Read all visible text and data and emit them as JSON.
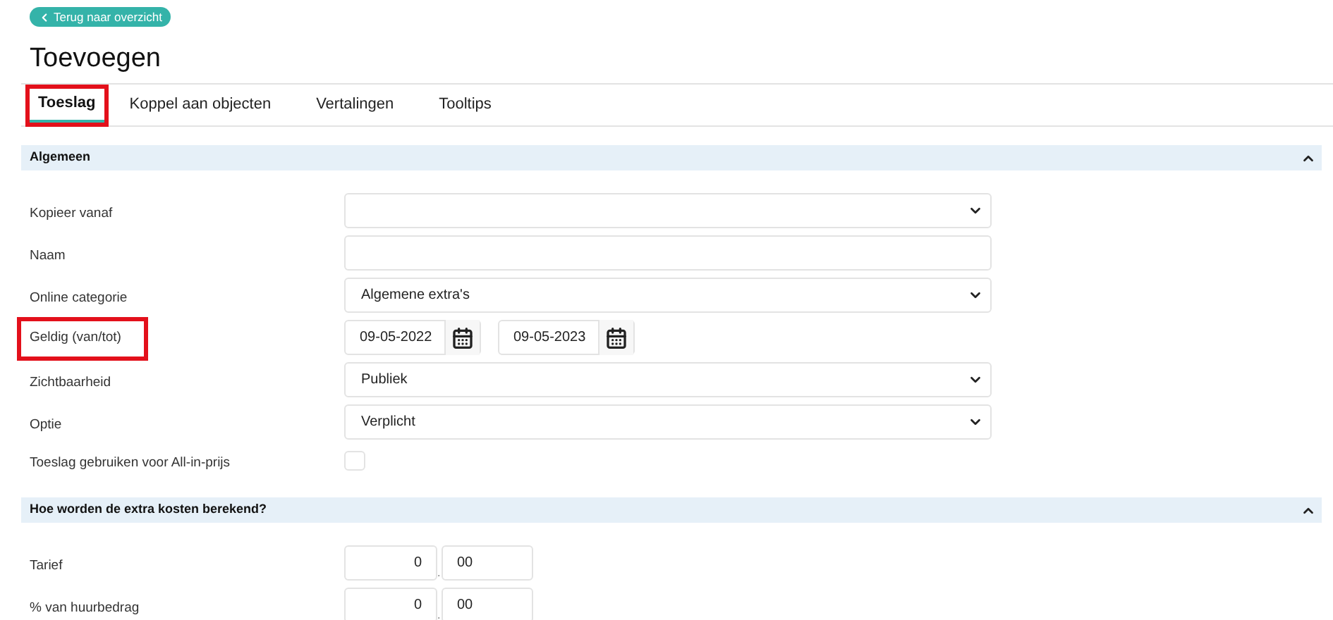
{
  "back_button": {
    "label": "Terug naar overzicht"
  },
  "title": "Toevoegen",
  "tabs": [
    {
      "label": "Toeslag",
      "selected": true,
      "highlighted": true
    },
    {
      "label": "Koppel aan objecten",
      "selected": false,
      "highlighted": false
    },
    {
      "label": "Vertalingen",
      "selected": false,
      "highlighted": false
    },
    {
      "label": "Tooltips",
      "selected": false,
      "highlighted": false
    }
  ],
  "sections": [
    {
      "title": "Algemeen",
      "expanded": true,
      "fields": [
        {
          "kind": "select",
          "label": "Kopieer vanaf",
          "highlighted": false
        },
        {
          "kind": "text",
          "label": "Naam",
          "highlighted": false
        },
        {
          "kind": "select",
          "label": "Online categorie",
          "value": "Algemene extra's",
          "highlighted": false
        },
        {
          "kind": "date_range",
          "label": "Geldig (van/tot)",
          "from": "09-05-2022",
          "to": "09-05-2023",
          "highlighted": true
        },
        {
          "kind": "select",
          "label": "Zichtbaarheid",
          "value": "Publiek",
          "highlighted": false
        },
        {
          "kind": "select",
          "label": "Optie",
          "value": "Verplicht",
          "highlighted": false
        },
        {
          "kind": "checkbox",
          "label": "Toeslag gebruiken voor All-in-prijs",
          "checked": false,
          "highlighted": false
        }
      ]
    },
    {
      "title": "Hoe worden de extra kosten berekend?",
      "expanded": true,
      "fields": [
        {
          "kind": "decimal",
          "label": "Tarief",
          "whole": "0",
          "separator": ".",
          "fraction": "00",
          "highlighted": false
        },
        {
          "kind": "decimal",
          "label": "% van huurbedrag",
          "whole": "0",
          "separator": ".",
          "fraction": "00",
          "highlighted": false
        }
      ]
    }
  ]
}
